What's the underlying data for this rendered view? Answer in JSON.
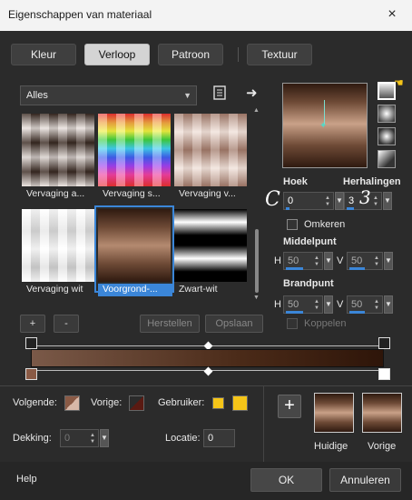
{
  "window": {
    "title": "Eigenschappen van materiaal",
    "close_icon": "×"
  },
  "tabs": [
    {
      "label": "Kleur",
      "active": false
    },
    {
      "label": "Verloop",
      "active": true
    },
    {
      "label": "Patroon",
      "active": false
    },
    {
      "label": "Textuur",
      "active": false
    }
  ],
  "category": {
    "selected": "Alles"
  },
  "presets": [
    {
      "label": "Vervaging a...",
      "icon": "gradient-preset",
      "selected": false
    },
    {
      "label": "Vervaging s...",
      "icon": "gradient-preset",
      "selected": false
    },
    {
      "label": "Vervaging v...",
      "icon": "gradient-preset",
      "selected": false
    },
    {
      "label": "Vervaging wit",
      "icon": "gradient-preset",
      "selected": false
    },
    {
      "label": "Voorgrond-...",
      "icon": "gradient-preset",
      "selected": true
    },
    {
      "label": "Zwart-wit",
      "icon": "gradient-preset",
      "selected": false
    }
  ],
  "preset_buttons": {
    "add": "+",
    "remove": "-",
    "reset": "Herstellen",
    "save": "Opslaan"
  },
  "angle": {
    "label": "Hoek",
    "value": "0",
    "annotation": "C"
  },
  "repeats": {
    "label": "Herhalingen",
    "value": "3",
    "annotation": "3"
  },
  "invert": {
    "label": "Omkeren"
  },
  "center": {
    "label": "Middelpunt",
    "h_label": "H",
    "h_value": "50",
    "v_label": "V",
    "v_value": "50"
  },
  "focal": {
    "label": "Brandpunt",
    "h_label": "H",
    "h_value": "50",
    "v_label": "V",
    "v_value": "50"
  },
  "link": {
    "label": "Koppelen"
  },
  "stops": {
    "next_label": "Volgende:",
    "prev_label": "Vorige:",
    "user_label": "Gebruiker:",
    "opacity_label": "Dekking:",
    "opacity_value": "0",
    "location_label": "Locatie:",
    "location_value": "0"
  },
  "colors": {
    "accent": "#3b86d8",
    "next": "#8a5a45",
    "prev": "#5a1a12",
    "user1": "#f5c518",
    "user2": "#f5c518"
  },
  "thumbs": {
    "current_label": "Huidige",
    "previous_label": "Vorige"
  },
  "footer": {
    "help": "Help",
    "ok": "OK",
    "cancel": "Annuleren"
  }
}
